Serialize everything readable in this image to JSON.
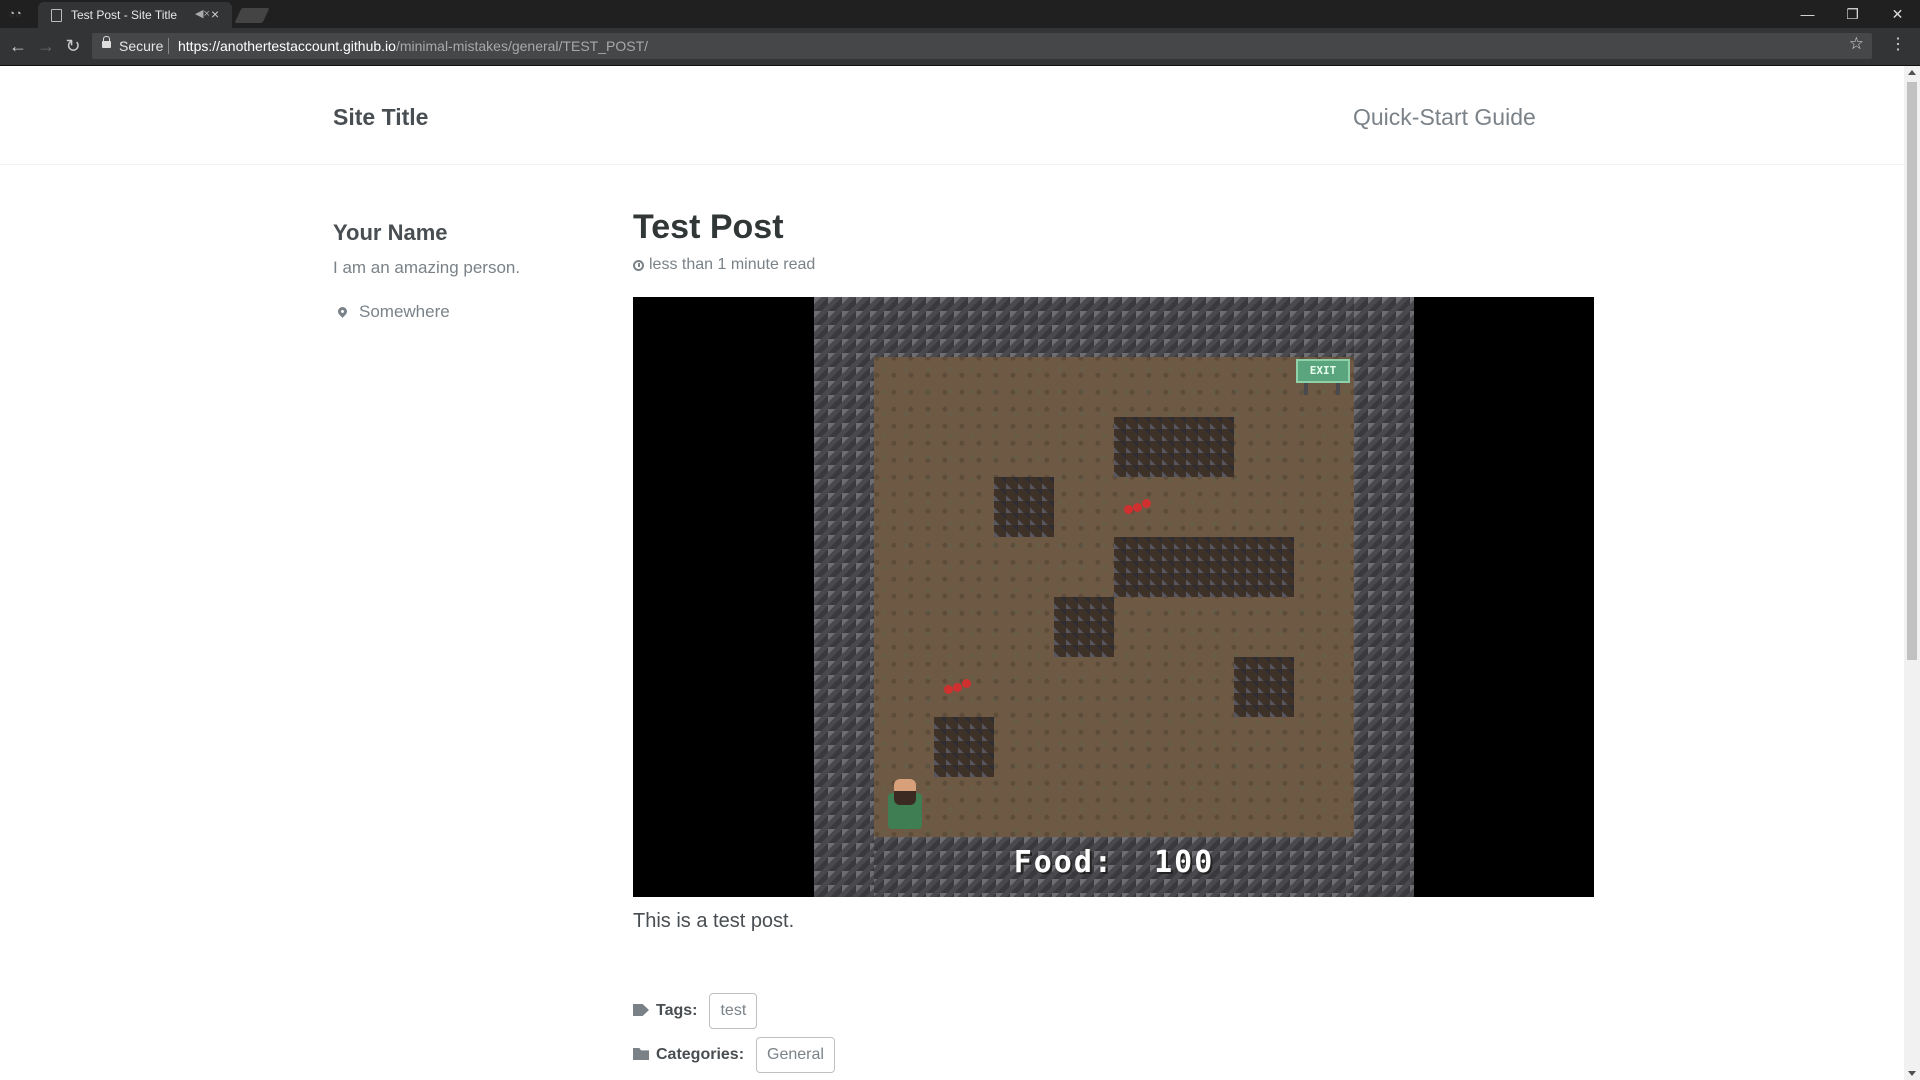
{
  "browser": {
    "tab_title": "Test Post - Site Title",
    "omnibox": {
      "secure_label": "Secure",
      "url_host": "https://anothertestaccount.github.io",
      "url_path": "/minimal-mistakes/general/TEST_POST/"
    }
  },
  "masthead": {
    "site_title": "Site Title",
    "nav_link": "Quick-Start Guide"
  },
  "author": {
    "name": "Your Name",
    "bio": "I am an amazing person.",
    "location": "Somewhere"
  },
  "post": {
    "title": "Test Post",
    "read_time": "less than 1 minute read",
    "body": "This is a test post.",
    "tags_label": "Tags:",
    "tags": [
      "test"
    ],
    "categories_label": "Categories:",
    "categories": [
      "General"
    ]
  },
  "game": {
    "food_label": "Food:",
    "food_value": "100",
    "exit_label": "EXIT"
  }
}
